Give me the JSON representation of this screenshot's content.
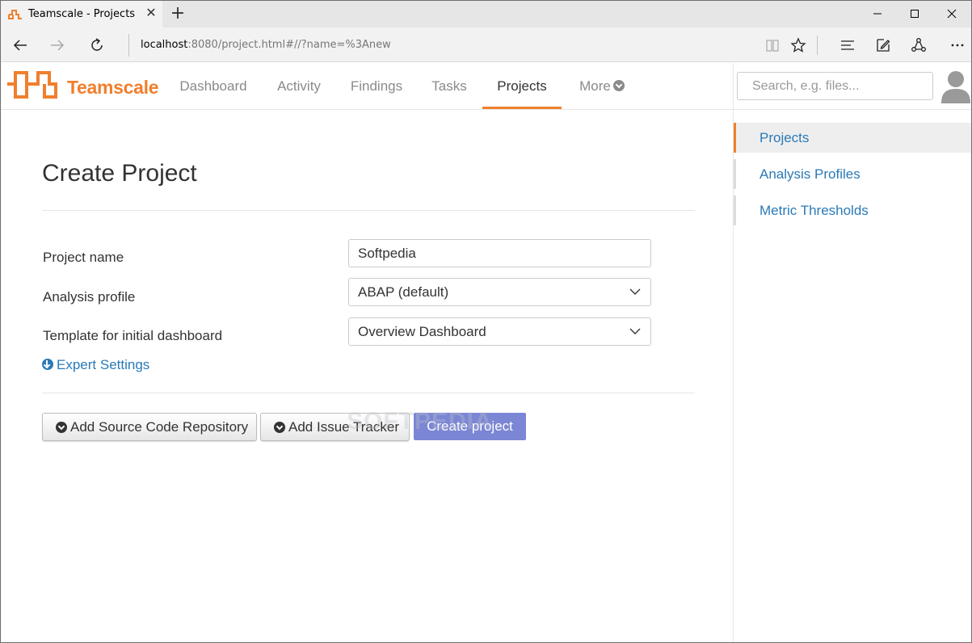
{
  "browser": {
    "tab_title": "Teamscale - Projects",
    "new_tab_symbol": "+",
    "url_host": "localhost",
    "url_rest": ":8080/project.html#//?name=%3Anew"
  },
  "header": {
    "brand": "Teamscale",
    "nav": [
      {
        "label": "Dashboard"
      },
      {
        "label": "Activity"
      },
      {
        "label": "Findings"
      },
      {
        "label": "Tasks"
      },
      {
        "label": "Projects"
      },
      {
        "label": "More"
      }
    ],
    "active_nav": "Projects",
    "search_placeholder": "Search, e.g. files..."
  },
  "main": {
    "title": "Create Project",
    "form": {
      "project_name_label": "Project name",
      "project_name_value": "Softpedia",
      "analysis_profile_label": "Analysis profile",
      "analysis_profile_value": "ABAP (default)",
      "template_label": "Template for initial dashboard",
      "template_value": "Overview Dashboard",
      "expert_settings": "Expert Settings"
    },
    "buttons": {
      "add_repo": "Add Source Code Repository",
      "add_issue_tracker": "Add Issue Tracker",
      "create": "Create project"
    },
    "watermark": "SOFTPEDIA"
  },
  "sidebar": {
    "items": [
      {
        "label": "Projects"
      },
      {
        "label": "Analysis Profiles"
      },
      {
        "label": "Metric Thresholds"
      }
    ],
    "active": "Projects"
  },
  "colors": {
    "accent": "#f07f2d",
    "link": "#2a7ab8",
    "primary_button": "#7b87d4"
  }
}
